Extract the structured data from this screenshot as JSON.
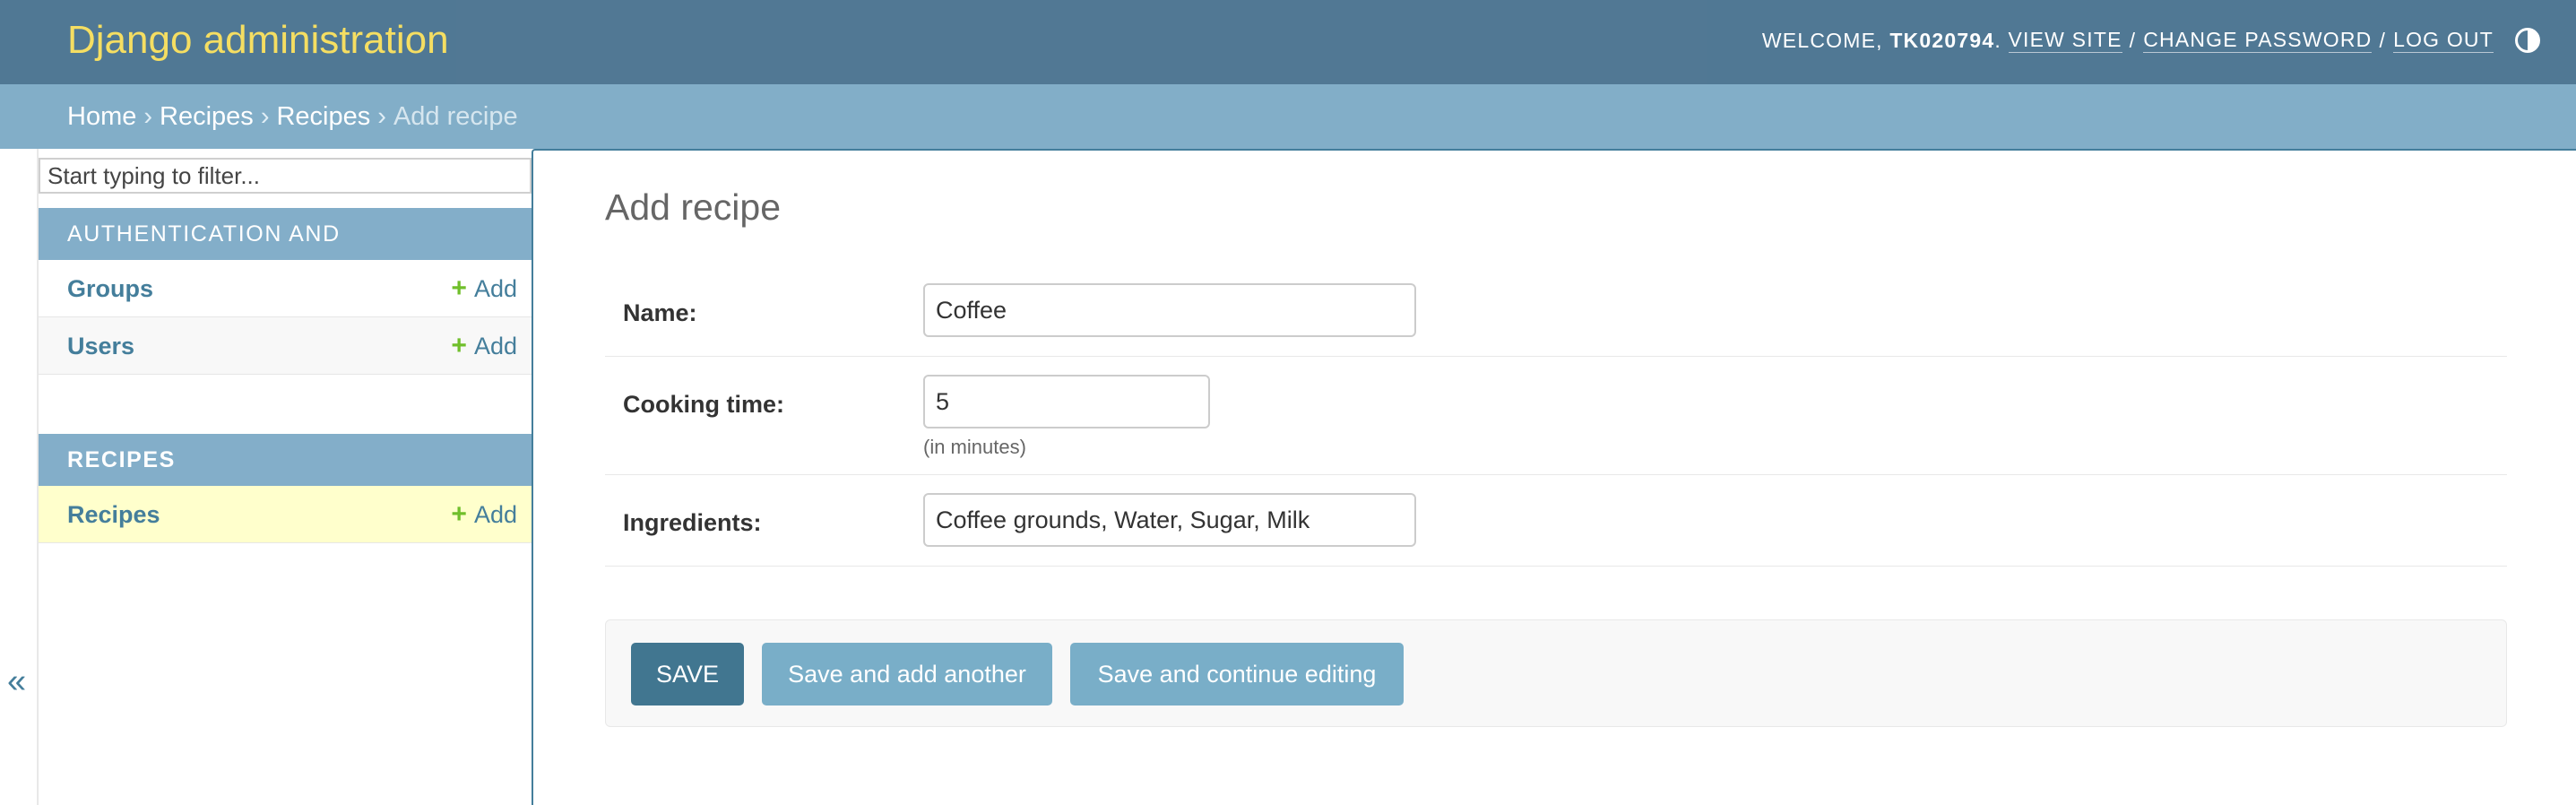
{
  "header": {
    "site_name": "Django administration",
    "welcome": "WELCOME,",
    "username": "TK020794",
    "username_suffix": ".",
    "view_site": "VIEW SITE",
    "change_password": "CHANGE PASSWORD",
    "log_out": "LOG OUT",
    "separator": "/"
  },
  "breadcrumbs": {
    "items": [
      "Home",
      "Recipes",
      "Recipes"
    ],
    "current": "Add recipe",
    "separator": "›"
  },
  "sidebar": {
    "filter_placeholder": "Start typing to filter...",
    "modules": [
      {
        "caption": "AUTHENTICATION AND AUTHORIZATION",
        "models": [
          {
            "name": "Groups",
            "add": "Add"
          },
          {
            "name": "Users",
            "add": "Add"
          }
        ]
      },
      {
        "caption": "RECIPES",
        "models": [
          {
            "name": "Recipes",
            "add": "Add"
          }
        ]
      }
    ],
    "add_glyph": "+",
    "collapse_glyph": "«"
  },
  "main": {
    "title": "Add recipe",
    "fields": {
      "name": {
        "label": "Name:",
        "value": "Coffee"
      },
      "cooking_time": {
        "label": "Cooking time:",
        "value": "5",
        "help": "(in minutes)"
      },
      "ingredients": {
        "label": "Ingredients:",
        "value": "Coffee grounds, Water, Sugar, Milk"
      }
    },
    "buttons": {
      "save": "SAVE",
      "save_add_another": "Save and add another",
      "save_continue": "Save and continue editing"
    }
  },
  "colors": {
    "header_bg": "#4b7491",
    "branding": "#f5dd5d",
    "breadcrumb_bg": "#82aec8",
    "primary_button": "#417690",
    "secondary_button": "#79aec8",
    "current_row": "#ffffcc",
    "add_icon": "#70bf2b"
  }
}
